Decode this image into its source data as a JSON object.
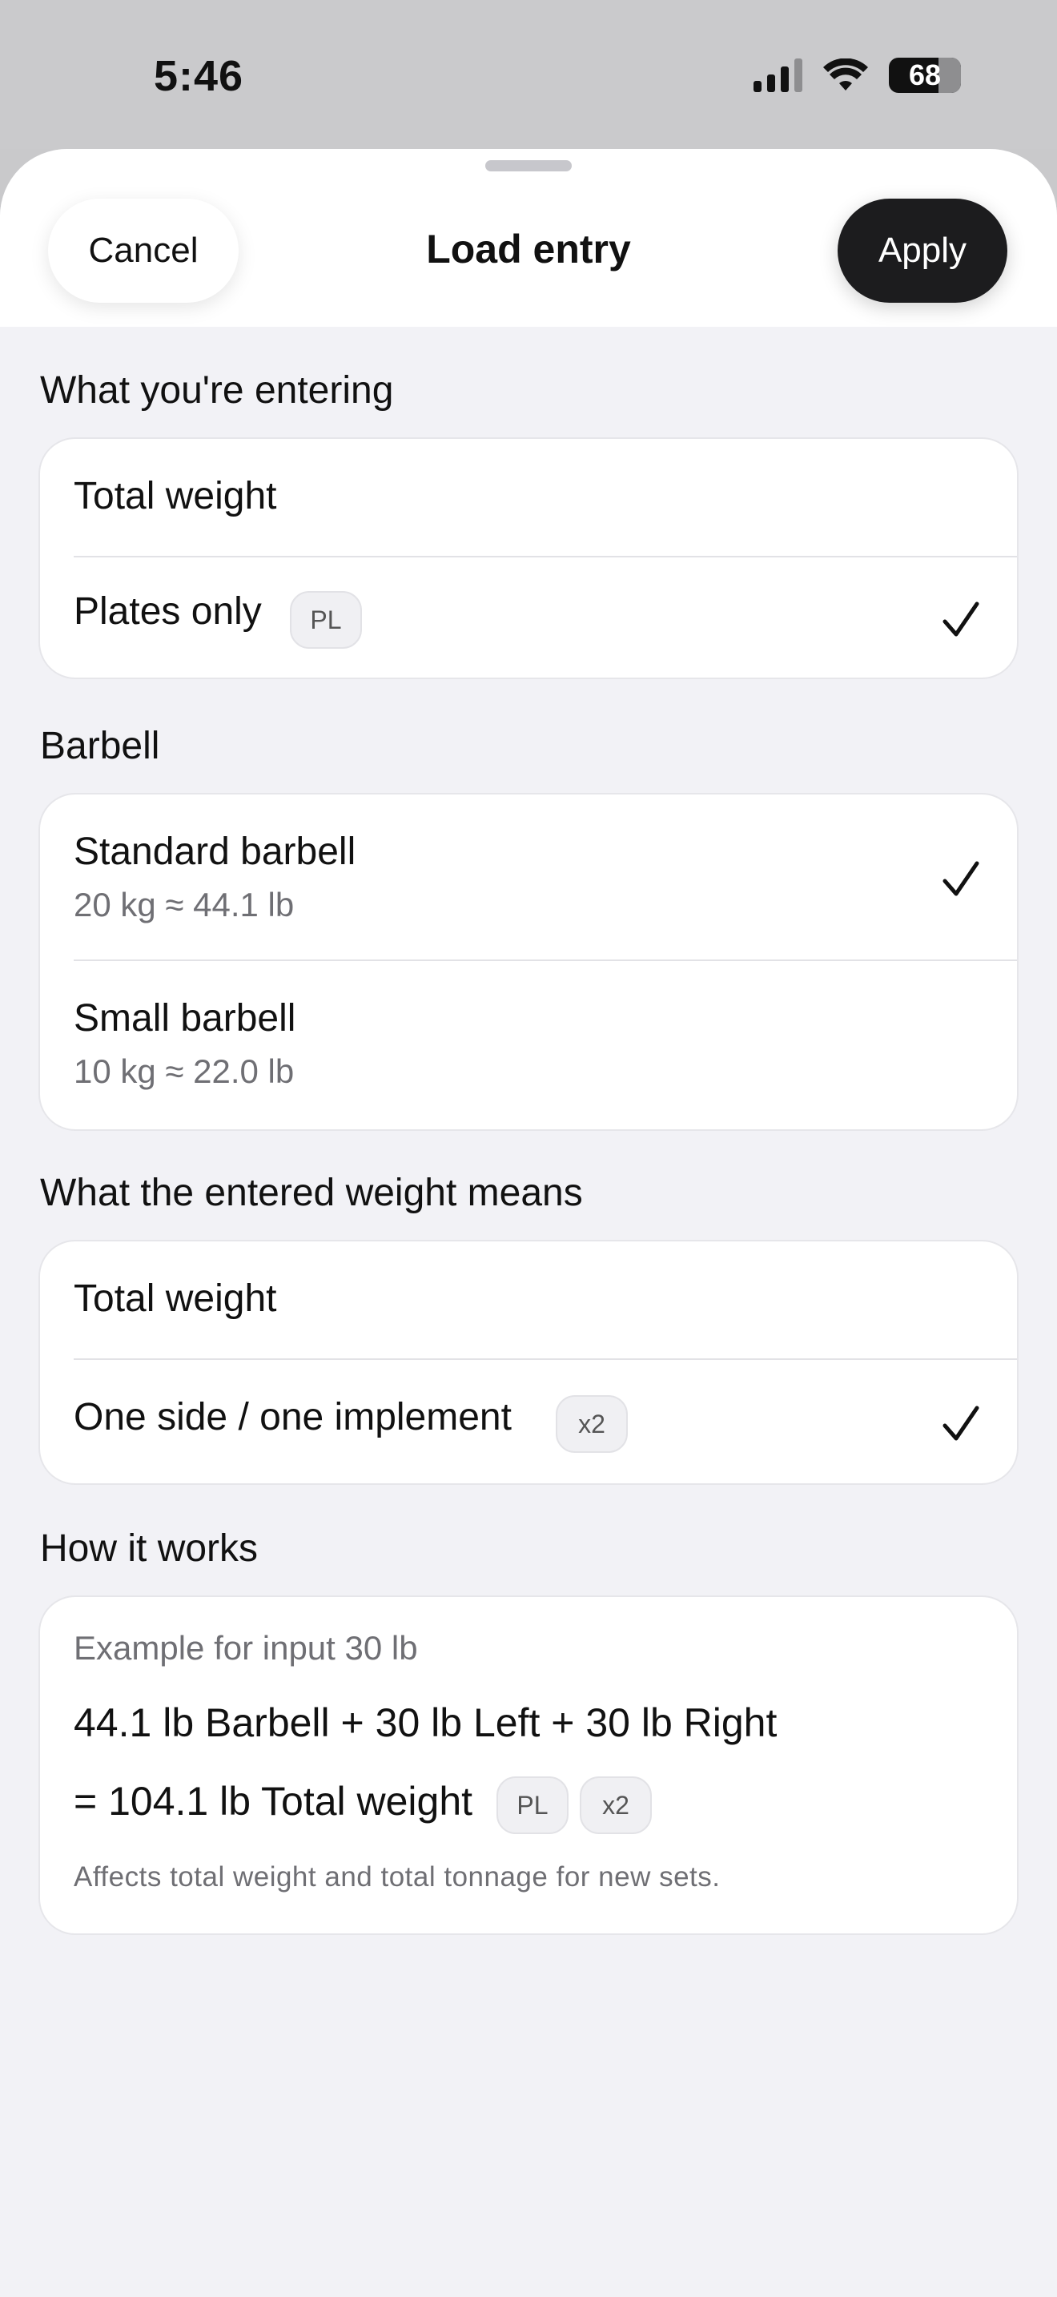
{
  "status_bar": {
    "time": "5:46",
    "battery": "68"
  },
  "header": {
    "cancel_label": "Cancel",
    "title": "Load entry",
    "apply_label": "Apply"
  },
  "entering": {
    "label": "What you're entering",
    "options": [
      {
        "label": "Total weight",
        "selected": false
      },
      {
        "label": "Plates only",
        "badge": "PL",
        "selected": true
      }
    ]
  },
  "barbell": {
    "label": "Barbell",
    "options": [
      {
        "label": "Standard barbell",
        "sub": "20 kg ≈ 44.1 lb",
        "selected": true
      },
      {
        "label": "Small barbell",
        "sub": "10 kg ≈ 22.0 lb",
        "selected": false
      }
    ]
  },
  "meaning": {
    "label": "What the entered weight means",
    "options": [
      {
        "label": "Total weight",
        "selected": false
      },
      {
        "label": "One side / one implement",
        "badge": "x2",
        "selected": true
      }
    ]
  },
  "how": {
    "label": "How it works",
    "caption": "Example for input 30 lb",
    "line1": "44.1 lb Barbell + 30 lb Left + 30 lb Right",
    "line2": "= 104.1 lb Total weight",
    "badges": [
      "PL",
      "x2"
    ],
    "footnote": "Affects total weight and total tonnage for new sets."
  },
  "colors": {
    "apply_bg": "#1c1c1e",
    "sheet_bg": "#f2f2f6",
    "status_bg": "#cacacc"
  }
}
